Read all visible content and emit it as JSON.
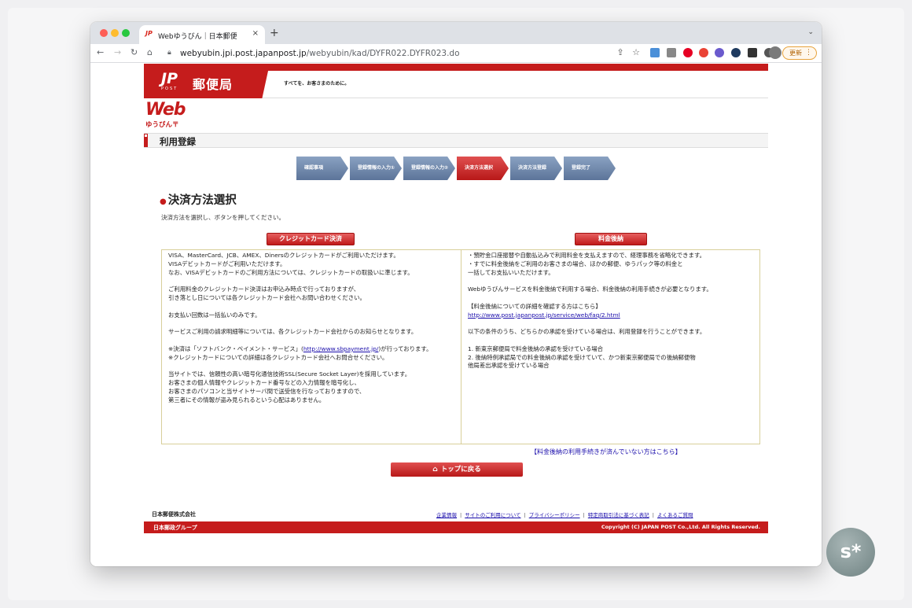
{
  "browser": {
    "tab_title": "Webゆうびん｜日本郵便",
    "tab_favicon": "JP",
    "tab_close": "×",
    "new_tab": "+",
    "tab_menu": "⌄",
    "url_host": "webyubin.jpi.post.japanpost.jp",
    "url_path": "/webyubin/kad/DYFR022.DYFR023.do",
    "update_label": "更新",
    "update_menu": "⋮",
    "icons": [
      "back-icon",
      "forward-icon",
      "reload-icon",
      "home-icon",
      "lock-icon",
      "share-icon",
      "bookmark-star-icon",
      "extension-icon",
      "profile-avatar"
    ]
  },
  "header": {
    "logo_mark": "JP",
    "logo_post": "POST",
    "logo_name": "郵便局",
    "slogan": "すべてを、お客さまのために。",
    "service_logo": "Web",
    "service_logo_sub": "ゆうびん〒"
  },
  "page_title": "利用登録",
  "steps": [
    {
      "label": "確認事項",
      "active": false
    },
    {
      "label": "登録情報の入力①",
      "active": false
    },
    {
      "label": "登録情報の入力②",
      "active": false
    },
    {
      "label": "決済方法選択",
      "active": true
    },
    {
      "label": "決済方法登録",
      "active": false
    },
    {
      "label": "登録完了",
      "active": false
    }
  ],
  "section": {
    "title": "決済方法選択",
    "instruction": "決済方法を選択し、ボタンを押してください。"
  },
  "choices": {
    "credit_card": "クレジットカード決済",
    "postpay": "料金後納"
  },
  "credit_info": {
    "p1": "VISA、MasterCard、JCB、AMEX、Dinersのクレジットカードがご利用いただけます。",
    "p2": "VISAデビットカードがご利用いただけます。",
    "p3": "なお、VISAデビットカードのご利用方法については、クレジットカードの取扱いに準じます。",
    "p4": "ご利用料金のクレジットカード決済はお申込み時点で行っておりますが、",
    "p5": "引き落とし日については各クレジットカード会社へお問い合わせください。",
    "p6": "お支払い回数は一括払いのみです。",
    "p7": "サービスご利用の請求明細等については、各クレジットカード会社からのお知らせとなります。",
    "p8_pre": "※決済は「ソフトバンク・ペイメント・サービス」(",
    "p8_link": "http://www.sbpayment.jp/",
    "p8_post": ")が行っております。",
    "p9": "※クレジットカードについての詳細は各クレジットカード会社へお問合せください。",
    "p10": "当サイトでは、信頼性の高い暗号化通信技術SSL(Secure Socket Layer)を採用しています。",
    "p11": "お客さまの個人情報やクレジットカード番号などの入力情報を暗号化し、",
    "p12": "お客さまのパソコンと当サイトサーバ間で送受信を行なっておりますので、",
    "p13": "第三者にその情報が盗み見られるという心配はありません。"
  },
  "postpay_info": {
    "p1": "・預貯金口座振替や自動払込みで利用料金を支払えますので、経理事務を省略化できます。",
    "p2": "・すでに料金後納をご利用のお客さまの場合、ほかの郵便、ゆうパック等の料金と",
    "p3": "一括してお支払いいただけます。",
    "p4": "Webゆうびんサービスを料金後納で利用する場合、料金後納の利用手続きが必要となります。",
    "p5": "【料金後納についての詳細を確認する方はこちら】",
    "p6_link": "http://www.post.japanpost.jp/service/web/faq/2.html",
    "p7": "以下の条件のうち、どちらかの承認を受けている場合は、利用登録を行うことができます。",
    "p8": "1. 新東京郵便局で料金後納の承認を受けている場合",
    "p9": "2. 後納特例承認局での料金後納の承認を受けていて、かつ新東京郵便局での後納郵便物",
    "p10": "他局差出承認を受けている場合"
  },
  "unregistered_link": "【料金後納の利用手続きが済んでいない方はこちら】",
  "top_button": "トップに戻る",
  "footer": {
    "company": "日本郵便株式会社",
    "links": [
      "企業情報",
      "サイトのご利用について",
      "プライバシーポリシー",
      "特定商取引法に基づく表記",
      "よくあるご質問"
    ],
    "separator": "|",
    "group": "日本郵政グループ",
    "copyright": "Copyright (C) JAPAN POST Co.,Ltd.  All Rights Reserved."
  },
  "badge": "s*"
}
